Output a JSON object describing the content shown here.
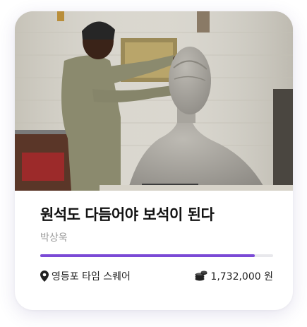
{
  "card": {
    "title": "원석도 다듬어야 보석이 된다",
    "author": "박상욱",
    "progress": 0.92,
    "accent_color": "#7b4ad6",
    "location": {
      "icon": "map-pin-icon",
      "text": "영등포 타임 스퀘어"
    },
    "amount": {
      "icon": "coin-stack-icon",
      "text": "1,732,000 원"
    },
    "image": {
      "subject": "sculptor-with-clay-bust"
    }
  }
}
